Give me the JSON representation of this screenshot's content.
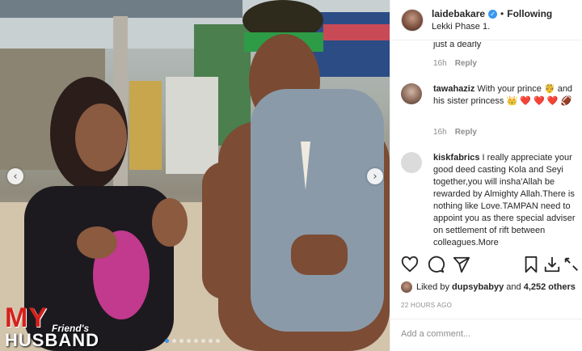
{
  "post": {
    "username": "laidebakare",
    "following_label": "Following",
    "separator": "•",
    "location": "Lekki Phase 1."
  },
  "comments": {
    "fragment_text": "just a dearly",
    "first_meta": {
      "time": "16h",
      "reply": "Reply"
    },
    "items": [
      {
        "username": "tawahaziz",
        "text": "With your prince 🤴 and his sister princess 👑 ❤️ ❤️ ❤️ 🏈",
        "time": "16h",
        "reply": "Reply"
      },
      {
        "username": "kiskfabrics",
        "text": "I really appreciate your good deed casting Kola and Seyi together,you will insha'Allah be rewarded by Almighty Allah.There is nothing like Love.TAMPAN need to appoint you as there special adviser on settlement of rift between colleagues.More"
      }
    ]
  },
  "likes": {
    "prefix": "Liked by",
    "user": "dupsybabyy",
    "connector": "and",
    "others": "4,252 others"
  },
  "date": "22 HOURS AGO",
  "add_comment": {
    "placeholder": "Add a comment..."
  },
  "media_overlay": {
    "logo_line1": "MY",
    "logo_small": "Friend's",
    "logo_line2": "HUSBAND",
    "slides_total": 8,
    "active_slide": 1
  },
  "colors": {
    "accent": "#3897f0",
    "heart": "#ed4956",
    "logo_red": "#d4211c"
  },
  "icons": [
    "verified-badge-icon",
    "heart-icon",
    "comment-icon",
    "share-icon",
    "bookmark-icon",
    "chevron-left-icon",
    "chevron-right-icon"
  ]
}
